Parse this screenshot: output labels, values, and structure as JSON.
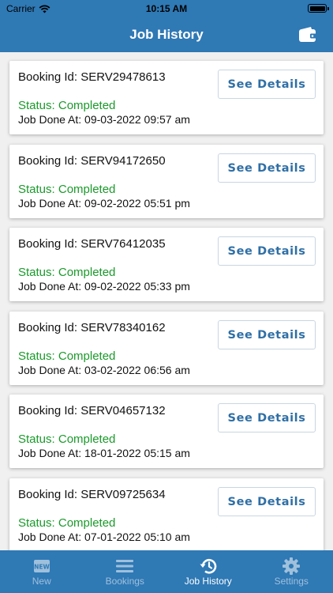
{
  "status_bar": {
    "carrier": "Carrier",
    "time": "10:15 AM"
  },
  "header": {
    "title": "Job History",
    "wallet_icon": "wallet-icon"
  },
  "colors": {
    "primary": "#2f79b5",
    "status_green": "#1a9a2a",
    "button_text": "#2f6fa5"
  },
  "jobs": [
    {
      "booking": "Booking Id: SERV29478613",
      "status": "Status: Completed",
      "done": "Job Done At: 09-03-2022 09:57 am",
      "button": "See Details"
    },
    {
      "booking": "Booking Id: SERV94172650",
      "status": "Status: Completed",
      "done": "Job Done At: 09-02-2022 05:51 pm",
      "button": "See Details"
    },
    {
      "booking": "Booking Id: SERV76412035",
      "status": "Status: Completed",
      "done": "Job Done At: 09-02-2022 05:33 pm",
      "button": "See Details"
    },
    {
      "booking": "Booking Id: SERV78340162",
      "status": "Status: Completed",
      "done": "Job Done At: 03-02-2022 06:56 am",
      "button": "See Details"
    },
    {
      "booking": "Booking Id: SERV04657132",
      "status": "Status: Completed",
      "done": "Job Done At: 18-01-2022 05:15 am",
      "button": "See Details"
    },
    {
      "booking": "Booking Id: SERV09725634",
      "status": "Status: Completed",
      "done": "Job Done At: 07-01-2022 05:10 am",
      "button": "See Details"
    }
  ],
  "tabs": [
    {
      "label": "New",
      "icon": "new-badge-icon",
      "active": false
    },
    {
      "label": "Bookings",
      "icon": "list-icon",
      "active": false
    },
    {
      "label": "Job History",
      "icon": "history-icon",
      "active": true
    },
    {
      "label": "Settings",
      "icon": "gear-icon",
      "active": false
    }
  ]
}
